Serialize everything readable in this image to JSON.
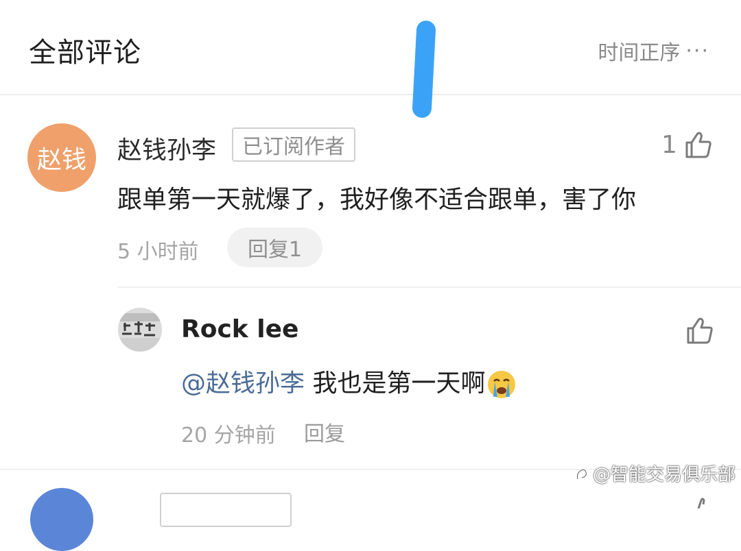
{
  "header": {
    "title": "全部评论",
    "sort_label": "时间正序",
    "more": "···"
  },
  "comment": {
    "avatar_text": "赵钱",
    "username": "赵钱孙李",
    "badge": "已订阅作者",
    "like_count": "1",
    "text": "跟单第一天就爆了，我好像不适合跟单，害了你",
    "time": "5 小时前",
    "reply_button": "回复1"
  },
  "reply": {
    "username": "Rock lee",
    "mention": "@赵钱孙李",
    "text": " 我也是第一天啊",
    "emoji": "crying-face",
    "time": "20 分钟前",
    "reply_label": "回复"
  },
  "watermark": {
    "text": "@智能交易俱乐部"
  },
  "colors": {
    "avatar_bg": "#f0a06a",
    "mention": "#4a6b96",
    "annotation_stroke": "#3ba3f7",
    "next_avatar_bg": "#5b86d8"
  }
}
